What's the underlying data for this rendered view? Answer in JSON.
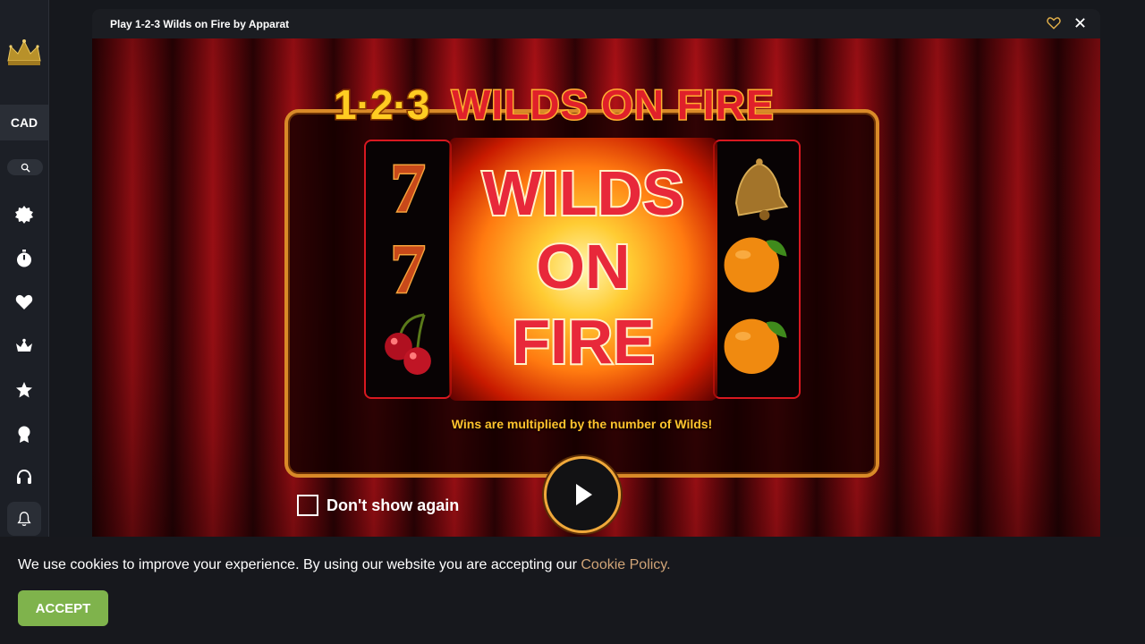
{
  "sidebar": {
    "currency": "CAD",
    "icons": [
      "crown-logo-icon",
      "search-icon",
      "new-badge-icon",
      "stopwatch-icon",
      "heart-icon",
      "crown-icon",
      "star-icon",
      "award-icon",
      "headset-icon",
      "bell-icon"
    ]
  },
  "game": {
    "window_title": "Play 1-2-3 Wilds on Fire by Apparat",
    "logo_text_numbers": "1·2·3",
    "logo_text_words": "WILDS ON FIRE",
    "feature_line1": "WILDS",
    "feature_line2": "ON",
    "feature_line3": "FIRE",
    "caption": "Wins are multiplied by the number of Wilds!",
    "dont_show_label": "Don't show again",
    "reel_left_symbols": [
      "seven",
      "seven",
      "cherries"
    ],
    "reel_right_symbols": [
      "bell",
      "orange",
      "orange"
    ]
  },
  "cookie": {
    "text": "We use cookies to improve your experience. By using our website you are accepting our ",
    "link": "Cookie Policy.",
    "accept": "ACCEPT"
  },
  "colors": {
    "accent_gold": "#d98a28",
    "accept_green": "#7fb34c",
    "link_tan": "#d0a477",
    "curtain_red": "#d0141b"
  }
}
